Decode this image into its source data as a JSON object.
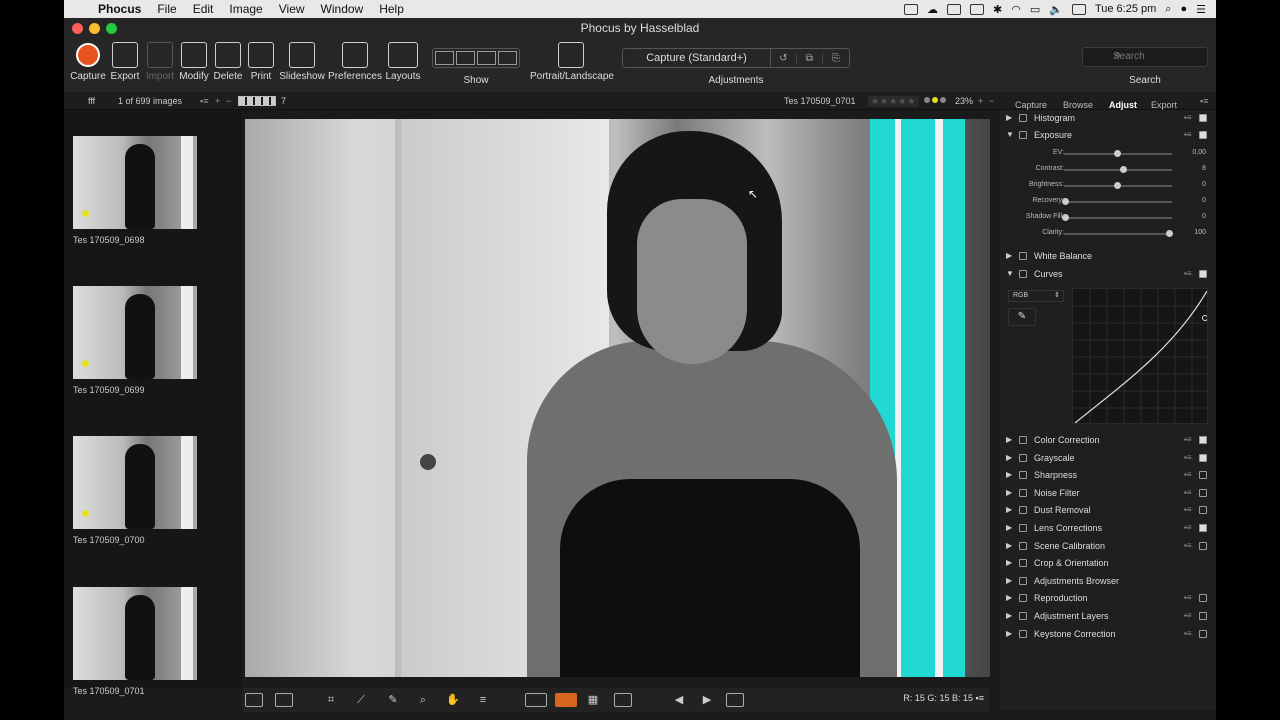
{
  "menubar": {
    "apple": "",
    "items": [
      "Phocus",
      "File",
      "Edit",
      "Image",
      "View",
      "Window",
      "Help"
    ],
    "clock": "Tue 6:25 pm"
  },
  "window": {
    "title": "Phocus by Hasselblad"
  },
  "toolbar": {
    "capture": "Capture",
    "export": "Export",
    "import": "Import",
    "modify": "Modify",
    "delete": "Delete",
    "print": "Print",
    "slideshow": "Slideshow",
    "preferences": "Preferences",
    "layouts": "Layouts",
    "show": "Show",
    "portrait_landscape": "Portrait/Landscape",
    "preset": "Capture (Standard+)",
    "adjustments": "Adjustments",
    "search_placeholder": "Search",
    "search_label": "Search"
  },
  "infobar": {
    "folder": "fff",
    "count": "1 of 699 images",
    "ratio_count": "7",
    "current_image": "Tes 170509_0701",
    "zoom": "23%",
    "tabs": [
      "Capture",
      "Browse",
      "Adjust",
      "Export"
    ],
    "active_tab": "Adjust"
  },
  "thumbnails": [
    {
      "name": "Tes 170509_0698",
      "rating": 0
    },
    {
      "name": "Tes 170509_0699",
      "rating": 0
    },
    {
      "name": "Tes 170509_0700",
      "rating": 0
    },
    {
      "name": "Tes 170509_0701",
      "rating": 0
    }
  ],
  "panel": {
    "histogram": "Histogram",
    "exposure": {
      "label": "Exposure",
      "sliders": [
        {
          "label": "EV:",
          "value": "0,00",
          "fraction": 0.5
        },
        {
          "label": "Contrast:",
          "value": "8",
          "fraction": 0.56
        },
        {
          "label": "Brightness:",
          "value": "0",
          "fraction": 0.5
        },
        {
          "label": "Recovery:",
          "value": "0",
          "fraction": 0.0
        },
        {
          "label": "Shadow Fill:",
          "value": "0",
          "fraction": 0.0
        },
        {
          "label": "Clarity:",
          "value": "100",
          "fraction": 1.0
        }
      ]
    },
    "white_balance": "White Balance",
    "curves": {
      "label": "Curves",
      "channel": "RGB"
    },
    "tools": [
      {
        "label": "Color Correction",
        "checked": true
      },
      {
        "label": "Grayscale",
        "checked": true
      },
      {
        "label": "Sharpness",
        "checked": false
      },
      {
        "label": "Noise Filter",
        "checked": false
      },
      {
        "label": "Dust Removal",
        "checked": false
      },
      {
        "label": "Lens Corrections",
        "checked": true
      },
      {
        "label": "Scene Calibration",
        "checked": false
      },
      {
        "label": "Crop & Orientation",
        "checked": null
      },
      {
        "label": "Adjustments Browser",
        "checked": null
      },
      {
        "label": "Reproduction",
        "checked": false
      },
      {
        "label": "Adjustment Layers",
        "checked": false
      },
      {
        "label": "Keystone Correction",
        "checked": false
      }
    ]
  },
  "readout": {
    "r_label": "R:",
    "r": "15",
    "g_label": "G:",
    "g": "15",
    "b_label": "B:",
    "b": "15"
  },
  "colors": {
    "accent": "#e8541f",
    "mask": "#21d8d2",
    "rating_dot": "#e6e020"
  }
}
